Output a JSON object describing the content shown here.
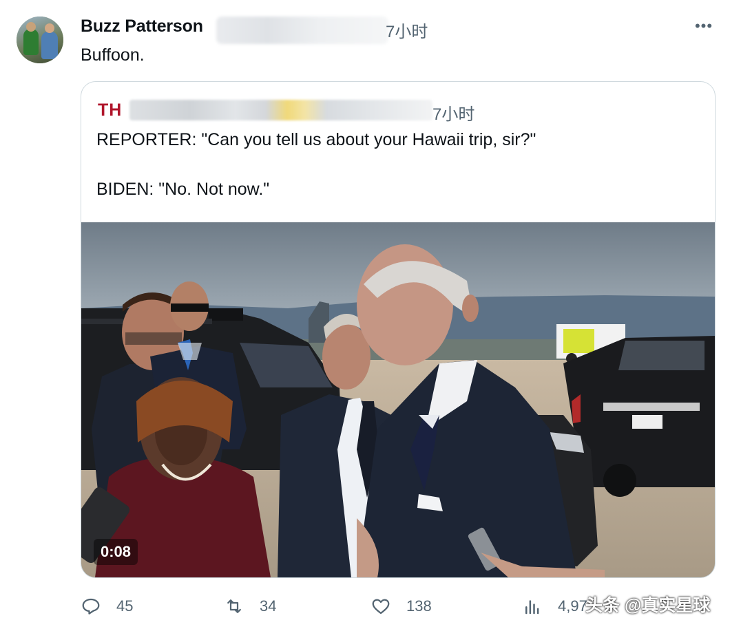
{
  "post": {
    "author_name": "Buzz Patterson",
    "time": "7小时",
    "text": "Buffoon.",
    "more_label": "•••"
  },
  "quoted": {
    "author_short": "TH",
    "time": "7小时",
    "line1": "REPORTER: \"Can you tell us about your Hawaii trip, sir?\"",
    "line2": "BIDEN: \"No. Not now.\"",
    "video_duration": "0:08"
  },
  "actions": {
    "replies": "45",
    "reposts": "34",
    "likes": "138",
    "views": "4,97"
  },
  "watermark": "头条 @真实星球",
  "icons": {
    "reply": "reply-icon",
    "repost": "repost-icon",
    "like": "heart-icon",
    "views": "views-icon",
    "more": "more-icon"
  },
  "colors": {
    "text_primary": "#0f1419",
    "text_secondary": "#536471",
    "quote_brand": "#b0152b",
    "border": "#cfd9de"
  }
}
